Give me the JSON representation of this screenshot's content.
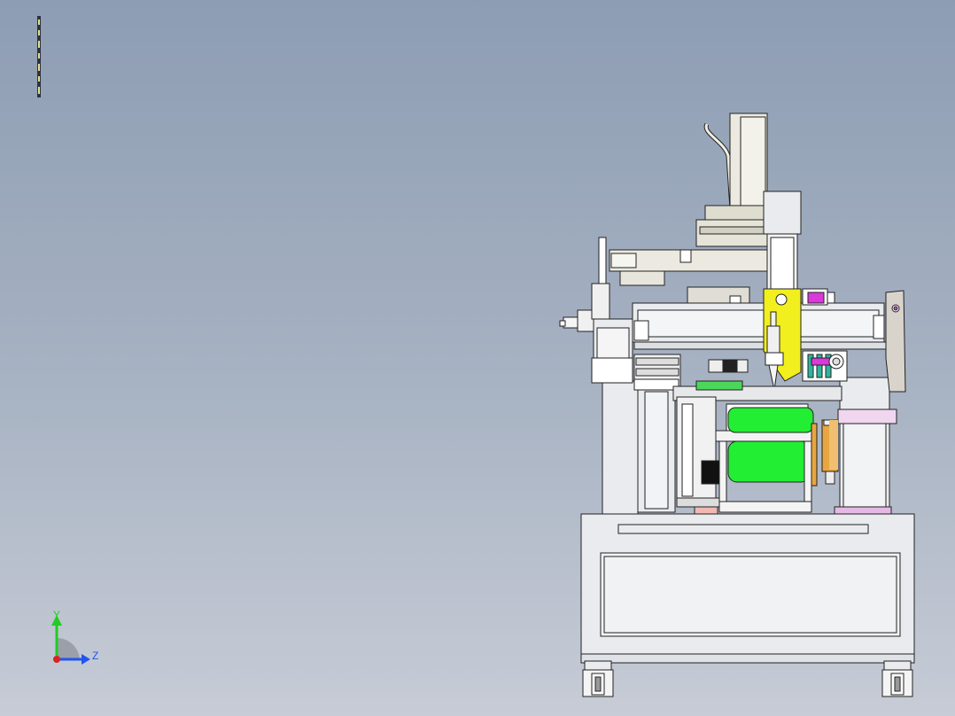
{
  "viewport": {
    "background_top": "#8d9db3",
    "background_bottom": "#c7ccd6"
  },
  "triad": {
    "y_label": "Y",
    "z_label": "Z",
    "y_color": "#22cc22",
    "z_color": "#2255ee",
    "x_color": "#dd2222"
  },
  "colors": {
    "frame": "#e9ebee",
    "outline": "#222222",
    "fixture": "#f2ef1e",
    "tank": "#22ee33",
    "accent": "#d93ad9",
    "cylinder": "#e8a640",
    "teal": "#2fb59d",
    "panel": "#d8d3cb"
  }
}
